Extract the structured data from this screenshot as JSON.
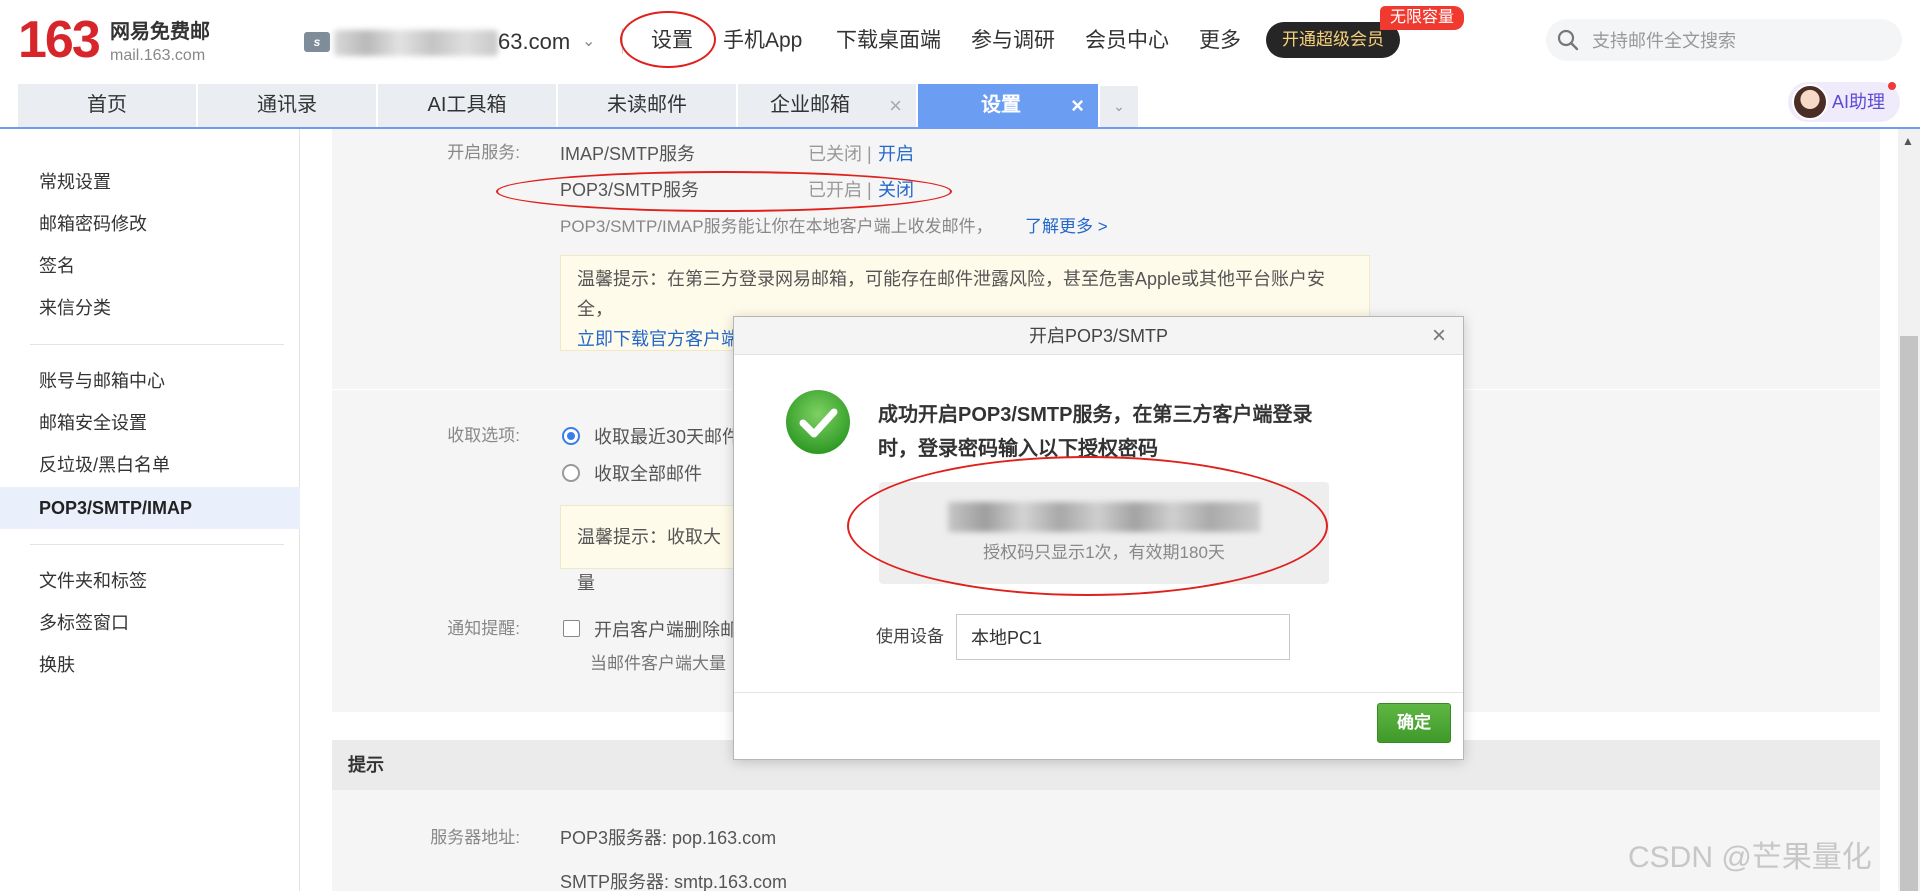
{
  "brand": {
    "logo_number": "163",
    "logo_cn": "网易免费邮",
    "logo_en": "mail.163.com"
  },
  "account": {
    "badge": "s",
    "suffix": "63.com"
  },
  "nav": {
    "items": [
      "设置",
      "手机App",
      "下载桌面端",
      "参与调研",
      "会员中心",
      "更多"
    ],
    "vip_label": "开通超级会员",
    "vip_tag": "无限容量"
  },
  "search": {
    "placeholder": "支持邮件全文搜索"
  },
  "tabs": [
    {
      "label": "首页"
    },
    {
      "label": "通讯录"
    },
    {
      "label": "AI工具箱"
    },
    {
      "label": "未读邮件"
    },
    {
      "label": "企业邮箱",
      "close": "×"
    },
    {
      "label": "设置",
      "close": "×",
      "active": true
    }
  ],
  "ai_assistant": {
    "label": "AI助理"
  },
  "sidebar": {
    "groups": [
      [
        "常规设置",
        "邮箱密码修改",
        "签名",
        "来信分类"
      ],
      [
        "账号与邮箱中心",
        "邮箱安全设置",
        "反垃圾/黑白名单",
        "POP3/SMTP/IMAP"
      ],
      [
        "文件夹和标签",
        "多标签窗口",
        "换肤"
      ]
    ],
    "active": "POP3/SMTP/IMAP"
  },
  "services": {
    "label": "开启服务:",
    "rows": [
      {
        "name": "IMAP/SMTP服务",
        "status": "已关闭",
        "sep": "|",
        "action": "开启"
      },
      {
        "name": "POP3/SMTP服务",
        "status": "已开启",
        "sep": "|",
        "action": "关闭"
      }
    ],
    "desc": "POP3/SMTP/IMAP服务能让你在本地客户端上收发邮件，",
    "learn_more": "了解更多 >",
    "tip_line1": "温馨提示：在第三方登录网易邮箱，可能存在邮件泄露风险，甚至危害Apple或其他平台账户安全，",
    "tip_link": "立即下载官方客户端"
  },
  "receive": {
    "label": "收取选项:",
    "options": [
      {
        "label": "收取最近30天邮件",
        "checked": true
      },
      {
        "label": "收取全部邮件",
        "checked": false
      }
    ],
    "tip": "温馨提示：收取大量"
  },
  "notify": {
    "label": "通知提醒:",
    "checkbox_label": "开启客户端删除邮",
    "sub_text": "当邮件客户端大量"
  },
  "hints": {
    "title": "提示",
    "server_label": "服务器地址:",
    "pop3": "POP3服务器: pop.163.com",
    "smtp": "SMTP服务器: smtp.163.com"
  },
  "modal": {
    "title": "开启POP3/SMTP",
    "close": "×",
    "message": "成功开启POP3/SMTP服务，在第三方客户端登录时，登录密码输入以下授权密码",
    "code_note": "授权码只显示1次，有效期180天",
    "device_label": "使用设备",
    "device_value": "本地PC1",
    "confirm": "确定"
  },
  "watermark": "CSDN @芒果量化",
  "colors": {
    "brand_red": "#d6262c",
    "tab_active": "#6b9ef2",
    "link": "#2468cc",
    "confirm_green": "#4caf35",
    "annotation_red": "#e0201c"
  }
}
